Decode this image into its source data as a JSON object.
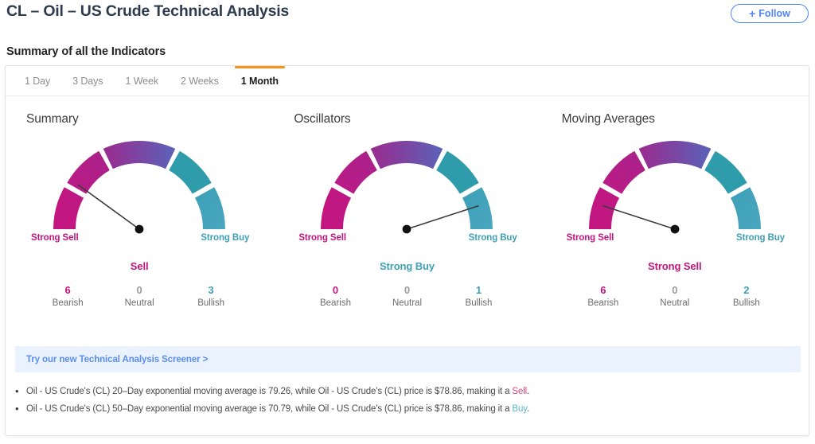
{
  "header": {
    "title": "CL – Oil – US Crude Technical Analysis",
    "follow_label": "Follow",
    "follow_plus": "+",
    "follow_icon": "plus-icon",
    "follow_color": "#4f86f7"
  },
  "section": {
    "title": "Summary of all the Indicators"
  },
  "tabs": [
    {
      "label": "1 Day",
      "active": false
    },
    {
      "label": "3 Days",
      "active": false
    },
    {
      "label": "1 Week",
      "active": false
    },
    {
      "label": "2 Weeks",
      "active": false
    },
    {
      "label": "1 Month",
      "active": true
    }
  ],
  "tab_active_color": "#f7921e",
  "edge_labels": {
    "left": "Strong Sell",
    "right": "Strong Buy"
  },
  "count_labels": {
    "bearish": "Bearish",
    "neutral": "Neutral",
    "bullish": "Bullish"
  },
  "gauges": [
    {
      "heading": "Summary",
      "verdict": "Sell",
      "verdict_color": "#c4157f",
      "needle_angle": -54,
      "bearish": "6",
      "neutral": "0",
      "bullish": "3"
    },
    {
      "heading": "Oscillators",
      "verdict": "Strong Buy",
      "verdict_color": "#3fa0b5",
      "needle_angle": 72,
      "bearish": "0",
      "neutral": "0",
      "bullish": "1"
    },
    {
      "heading": "Moving Averages",
      "verdict": "Strong Sell",
      "verdict_color": "#c4157f",
      "needle_angle": -72,
      "bearish": "6",
      "neutral": "0",
      "bullish": "2"
    }
  ],
  "gauge_colors": {
    "strong_sell": "#c4147f",
    "sell": "#b81a86",
    "neutral_left": "#9b2a8f",
    "neutral_right": "#5a63b8",
    "buy": "#2f9cab",
    "strong_buy": "#3c9fb6",
    "needle": "#3c3c3c",
    "hub": "#111111"
  },
  "screener": {
    "link_label": "Try our new Technical Analysis Screener >",
    "background": "#eaf2fd",
    "link_color": "#5b8def"
  },
  "bullets": [
    {
      "marker": "•",
      "prefix": "Oil - US Crude's (CL) 20–Day exponential moving average is 79.26, while Oil - US Crude's (CL) price is $78.86, making it a ",
      "verb": "Sell",
      "verb_kind": "sell",
      "suffix": "."
    },
    {
      "marker": "•",
      "prefix": "Oil - US Crude's (CL) 50–Day exponential moving average is 70.79, while Oil - US Crude's (CL) price is $78.86, making it a ",
      "verb": "Buy",
      "verb_kind": "buy",
      "suffix": "."
    }
  ]
}
